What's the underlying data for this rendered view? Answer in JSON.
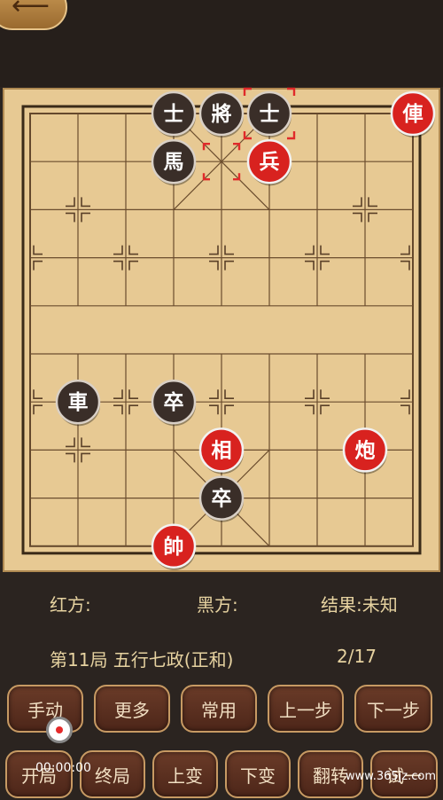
{
  "back_icon": "arrow-left-icon",
  "board": {
    "pieces": [
      {
        "char": "士",
        "side": "black",
        "col": 3,
        "row": 0
      },
      {
        "char": "將",
        "side": "black",
        "col": 4,
        "row": 0
      },
      {
        "char": "士",
        "side": "black",
        "col": 5,
        "row": 0,
        "selected": true
      },
      {
        "char": "俥",
        "side": "red",
        "col": 8,
        "row": 0
      },
      {
        "char": "馬",
        "side": "black",
        "col": 3,
        "row": 1
      },
      {
        "char": "兵",
        "side": "red",
        "col": 5,
        "row": 1
      },
      {
        "char": "車",
        "side": "black",
        "col": 1,
        "row": 6
      },
      {
        "char": "卒",
        "side": "black",
        "col": 3,
        "row": 6
      },
      {
        "char": "相",
        "side": "red",
        "col": 4,
        "row": 7
      },
      {
        "char": "炮",
        "side": "red",
        "col": 7,
        "row": 7
      },
      {
        "char": "卒",
        "side": "black",
        "col": 4,
        "row": 8
      },
      {
        "char": "帥",
        "side": "red",
        "col": 3,
        "row": 9
      }
    ],
    "move_from": {
      "col": 4,
      "row": 1
    }
  },
  "info": {
    "red_label": "红方:",
    "black_label": "黑方:",
    "result": "结果:未知",
    "game_title": "第11局 五行七政(正和)",
    "progress": "2/17"
  },
  "buttons_row1": [
    "手动",
    "更多",
    "常用",
    "上一步",
    "下一步"
  ],
  "buttons_row2": [
    "开局",
    "终局",
    "上变",
    "下变",
    "翻转",
    "试一"
  ],
  "recording": {
    "time": "00:00:00"
  },
  "watermark": "www.365jz.com"
}
